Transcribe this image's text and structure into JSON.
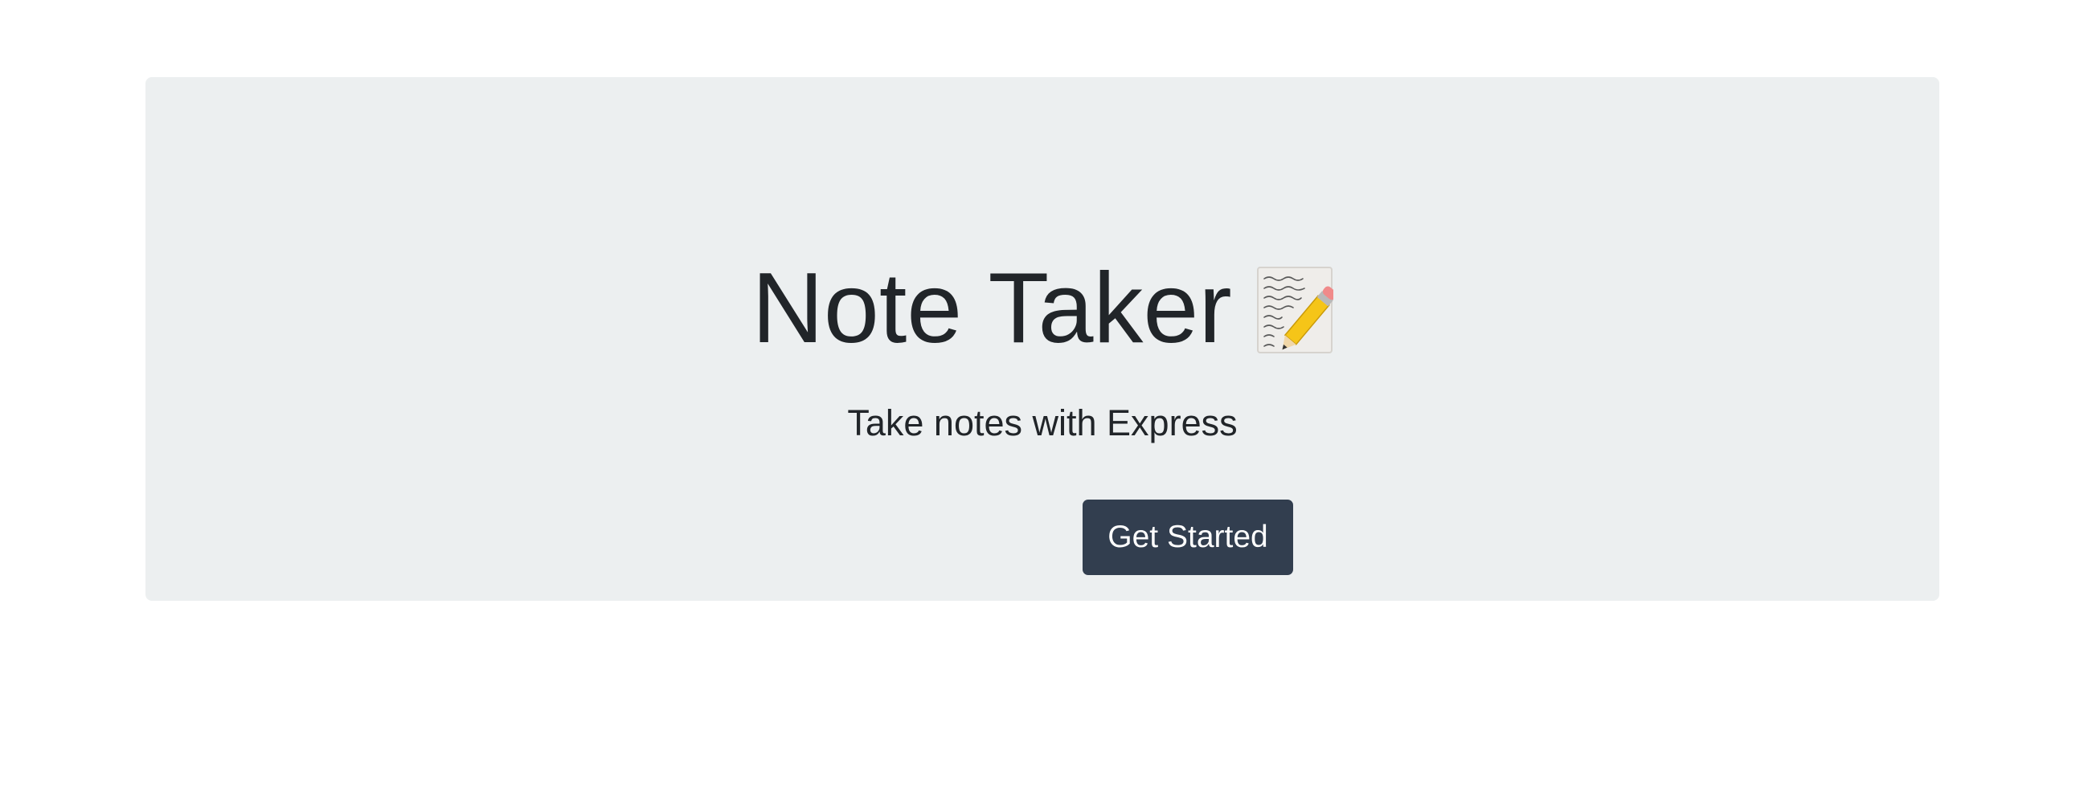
{
  "hero": {
    "title": "Note Taker",
    "title_icon": "memo-icon",
    "subtitle": "Take notes with Express",
    "cta_label": "Get Started"
  },
  "colors": {
    "page_background": "#ffffff",
    "jumbotron_background": "#eceff0",
    "text": "#212529",
    "button_background": "#323e4f",
    "button_text": "#ffffff"
  }
}
